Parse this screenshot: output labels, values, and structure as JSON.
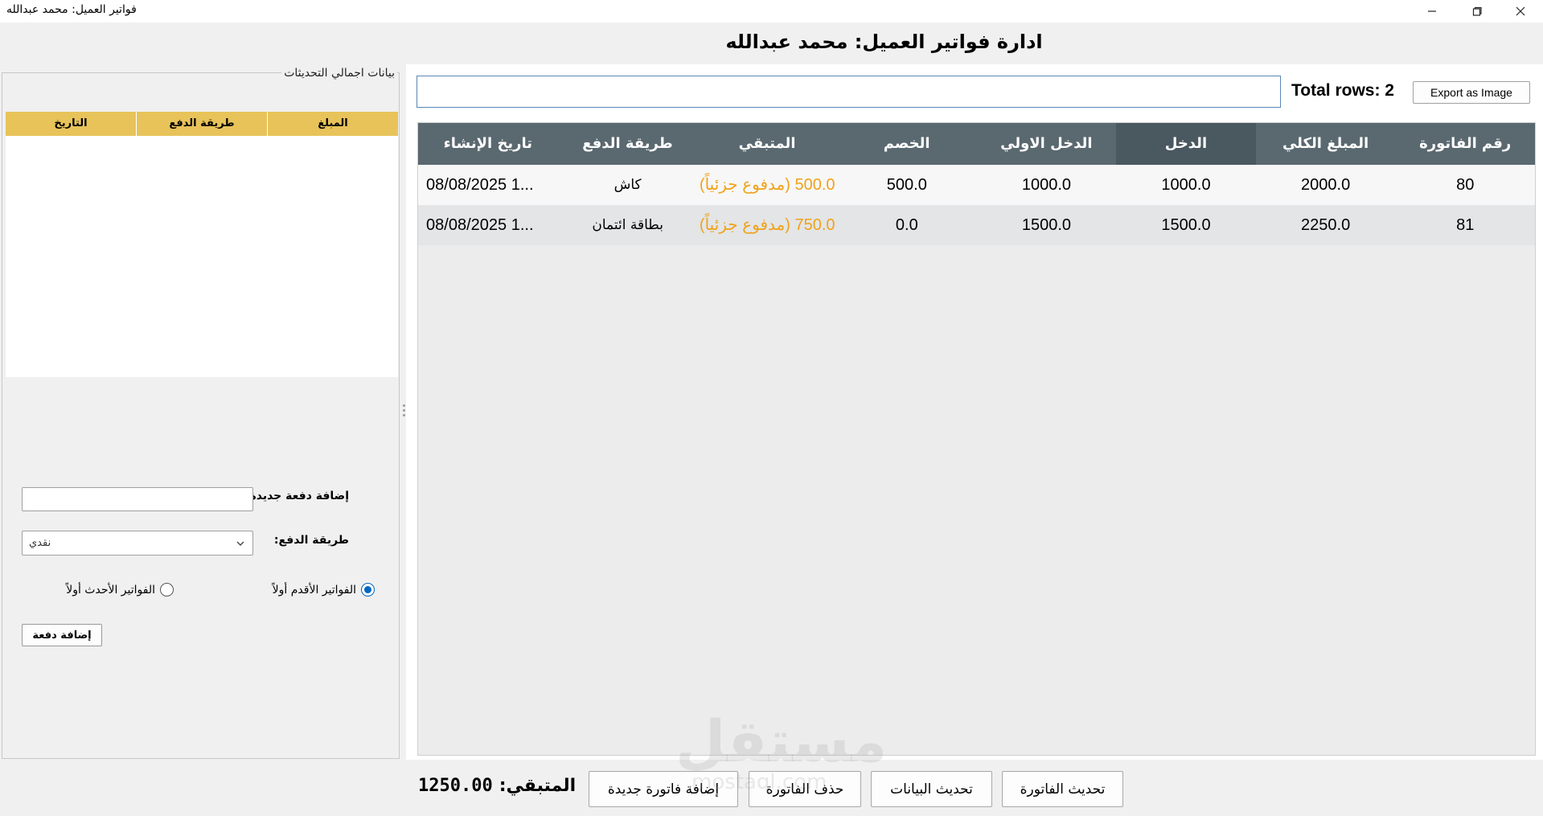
{
  "window": {
    "title": "فواتير العميل: محمد عبدالله",
    "minimize_icon": "minimize-icon",
    "maximize_icon": "restore-icon",
    "close_icon": "close-icon"
  },
  "header": {
    "title": "ادارة فواتير العميل: محمد عبدالله"
  },
  "left_panel": {
    "group_title": "بيانات اجمالي التحديثات",
    "table_headers": [
      "المبلغ",
      "طريقة الدفع",
      "التاريخ"
    ],
    "header_color": "#e8c35a",
    "amount_label": "إضافة دفعة جديدة:",
    "amount_value": "",
    "method_label": "طريقة الدفع:",
    "method_value": "نقدي",
    "radio_oldest": "الفواتير الأقدم أولاً",
    "radio_newest": "الفواتير الأحدث أولاً",
    "radio_selected": "oldest",
    "add_button": "إضافة دفعة"
  },
  "right_panel": {
    "search_value": "",
    "total_rows": "Total rows: 2",
    "export_button": "Export as Image",
    "columns": [
      "رقم الفاتورة",
      "المبلغ الكلي",
      "الدخل",
      "الدخل الاولي",
      "الخصم",
      "المتبقي",
      "طريقة الدفع",
      "تاريخ الإنشاء"
    ],
    "header_color": "#5a6870",
    "remaining_color": "#f0a21a",
    "rows": [
      [
        "80",
        "2000.0",
        "1000.0",
        "1000.0",
        "500.0",
        "500.0 (مدفوع جزئياً)",
        "كاش",
        "08/08/2025 1..."
      ],
      [
        "81",
        "2250.0",
        "1500.0",
        "1500.0",
        "0.0",
        "750.0 (مدفوع جزئياً)",
        "بطاقة ائتمان",
        "08/08/2025 1..."
      ]
    ]
  },
  "footer": {
    "remaining_label": "المتبقي:",
    "remaining_value": "1250.00",
    "btn_update_invoice": "تحديث الفاتورة",
    "btn_refresh_data": "تحديث البيانات",
    "btn_delete_invoice": "حذف الفاتورة",
    "btn_new_invoice": "إضافة فاتورة جديدة"
  },
  "watermark": {
    "text": "مستقل",
    "sub": "mostaql.com"
  }
}
